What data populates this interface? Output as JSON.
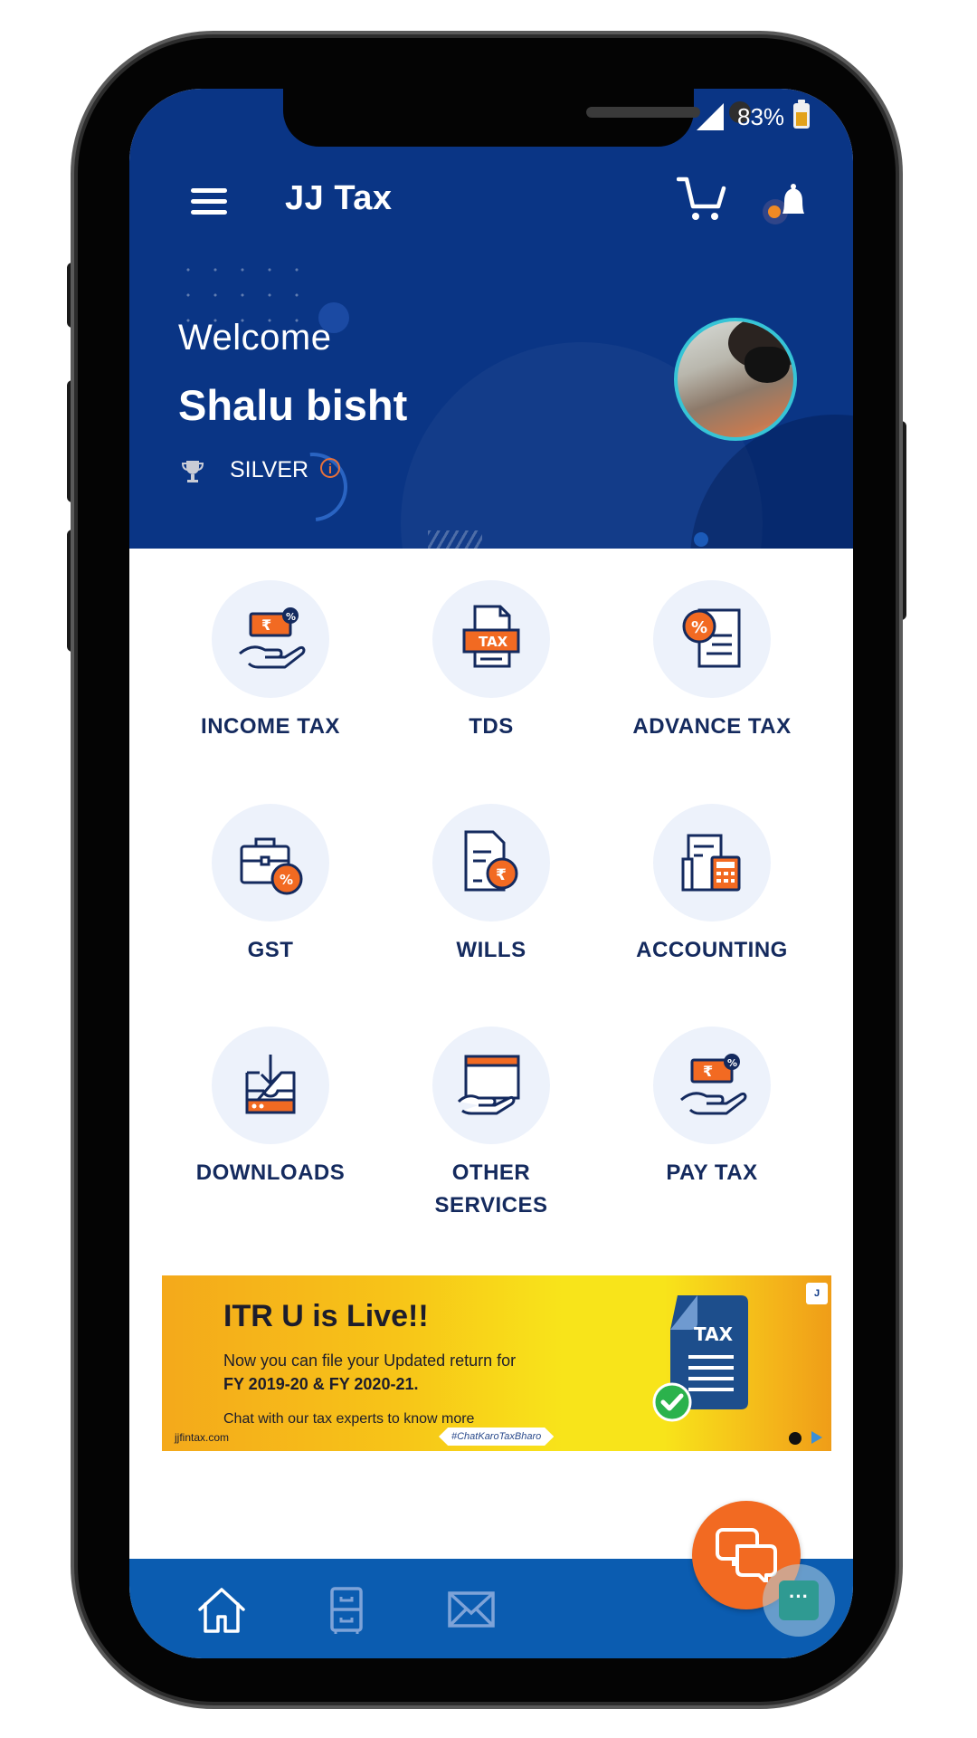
{
  "status_bar": {
    "battery": "83%"
  },
  "app_bar": {
    "title": "JJ Tax"
  },
  "profile": {
    "welcome": "Welcome",
    "name": "Shalu bisht",
    "tier": "SILVER"
  },
  "services": [
    {
      "label": "INCOME TAX",
      "icon": "income-tax-icon"
    },
    {
      "label": "TDS",
      "icon": "tds-icon",
      "badge": "TAX"
    },
    {
      "label": "ADVANCE TAX",
      "icon": "advance-tax-icon"
    },
    {
      "label": "GST",
      "icon": "gst-icon"
    },
    {
      "label": "WILLS",
      "icon": "wills-icon"
    },
    {
      "label": "ACCOUNTING",
      "icon": "accounting-icon"
    },
    {
      "label": "DOWNLOADS",
      "icon": "downloads-icon"
    },
    {
      "label": "OTHER SERVICES",
      "line1": "OTHER",
      "line2": "SERVICES",
      "icon": "other-services-icon"
    },
    {
      "label": "PAY TAX",
      "icon": "pay-tax-icon"
    }
  ],
  "banner": {
    "title": "ITR U is Live!!",
    "line1": "Now you can file your Updated return for",
    "line2": "FY 2019-20 & FY 2020-21.",
    "line3": "Chat with our tax experts to know more",
    "site": "jjfintax.com",
    "hashtag": "#ChatKaroTaxBharo",
    "doc_label": "TAX"
  },
  "colors": {
    "primary": "#0a3585",
    "accent": "#f26a22",
    "nav": "#0b5cb0",
    "banner": "#f8e41a"
  },
  "bottom_nav": [
    "home-icon",
    "cabinet-icon",
    "mail-icon"
  ]
}
